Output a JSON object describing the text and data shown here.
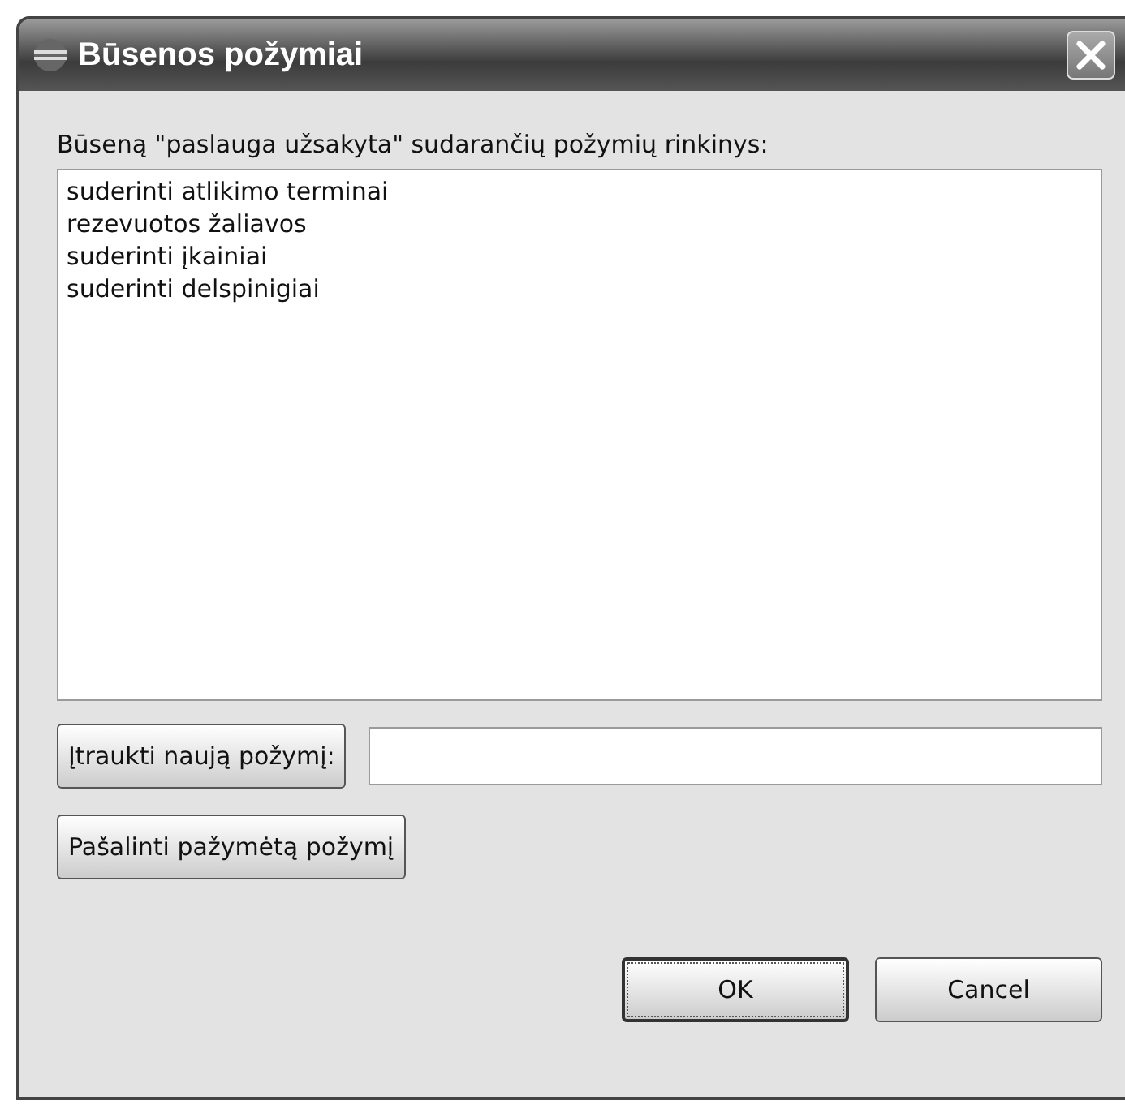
{
  "window": {
    "title": "Būsenos požymiai"
  },
  "list_label": "Būseną \"paslauga užsakyta\" sudarančių požymių rinkinys:",
  "list_items": [
    {
      "text": "suderinti atlikimo terminai"
    },
    {
      "text": "rezevuotos žaliavos"
    },
    {
      "text": "suderinti įkainiai"
    },
    {
      "text": "suderinti delspinigiai"
    }
  ],
  "add_button": "Įtraukti naują požymį:",
  "remove_button": "Pašalinti pažymėtą požymį",
  "buttons": [
    {
      "label": "OK",
      "default": true
    },
    {
      "label": "Cancel",
      "default": false
    }
  ]
}
